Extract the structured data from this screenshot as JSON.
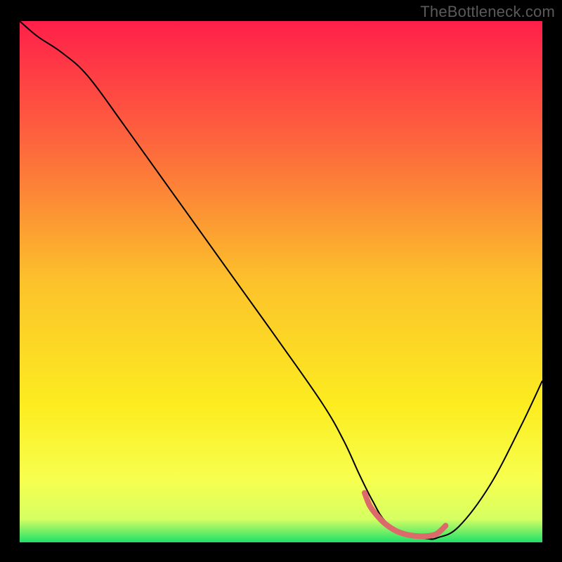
{
  "watermark": "TheBottleneck.com",
  "chart_data": {
    "type": "line",
    "title": "",
    "xlabel": "",
    "ylabel": "",
    "xlim": [
      0,
      100
    ],
    "ylim": [
      0,
      100
    ],
    "grid": false,
    "legend": false,
    "gradient_stops": [
      {
        "offset": 0.0,
        "color": "#ff1f4a"
      },
      {
        "offset": 0.25,
        "color": "#fd6b3c"
      },
      {
        "offset": 0.5,
        "color": "#fcc22b"
      },
      {
        "offset": 0.74,
        "color": "#fced20"
      },
      {
        "offset": 0.88,
        "color": "#f7ff4f"
      },
      {
        "offset": 0.955,
        "color": "#d6ff62"
      },
      {
        "offset": 1.0,
        "color": "#1fe06a"
      }
    ],
    "series": [
      {
        "name": "bottleneck-curve",
        "stroke": "#000000",
        "x": [
          0.0,
          3.5,
          8.0,
          13.0,
          20.0,
          30.0,
          40.0,
          50.0,
          58.0,
          62.0,
          65.0,
          67.5,
          70.0,
          74.0,
          78.0,
          80.0,
          84.0,
          90.0,
          96.0,
          100.0
        ],
        "y": [
          100.0,
          97.0,
          94.0,
          89.5,
          80.0,
          66.0,
          52.0,
          38.0,
          26.5,
          19.5,
          13.0,
          8.0,
          4.0,
          1.5,
          0.7,
          0.9,
          3.0,
          11.0,
          22.5,
          31.0
        ]
      },
      {
        "name": "optimal-band",
        "stroke": "#dc6a6a",
        "stroke_width": 8,
        "x": [
          66.0,
          67.0,
          68.5,
          70.0,
          72.0,
          74.0,
          76.0,
          78.0,
          79.5,
          80.5,
          81.5
        ],
        "y": [
          9.5,
          7.0,
          5.0,
          3.5,
          2.2,
          1.5,
          1.2,
          1.2,
          1.5,
          2.2,
          3.2
        ]
      }
    ]
  }
}
